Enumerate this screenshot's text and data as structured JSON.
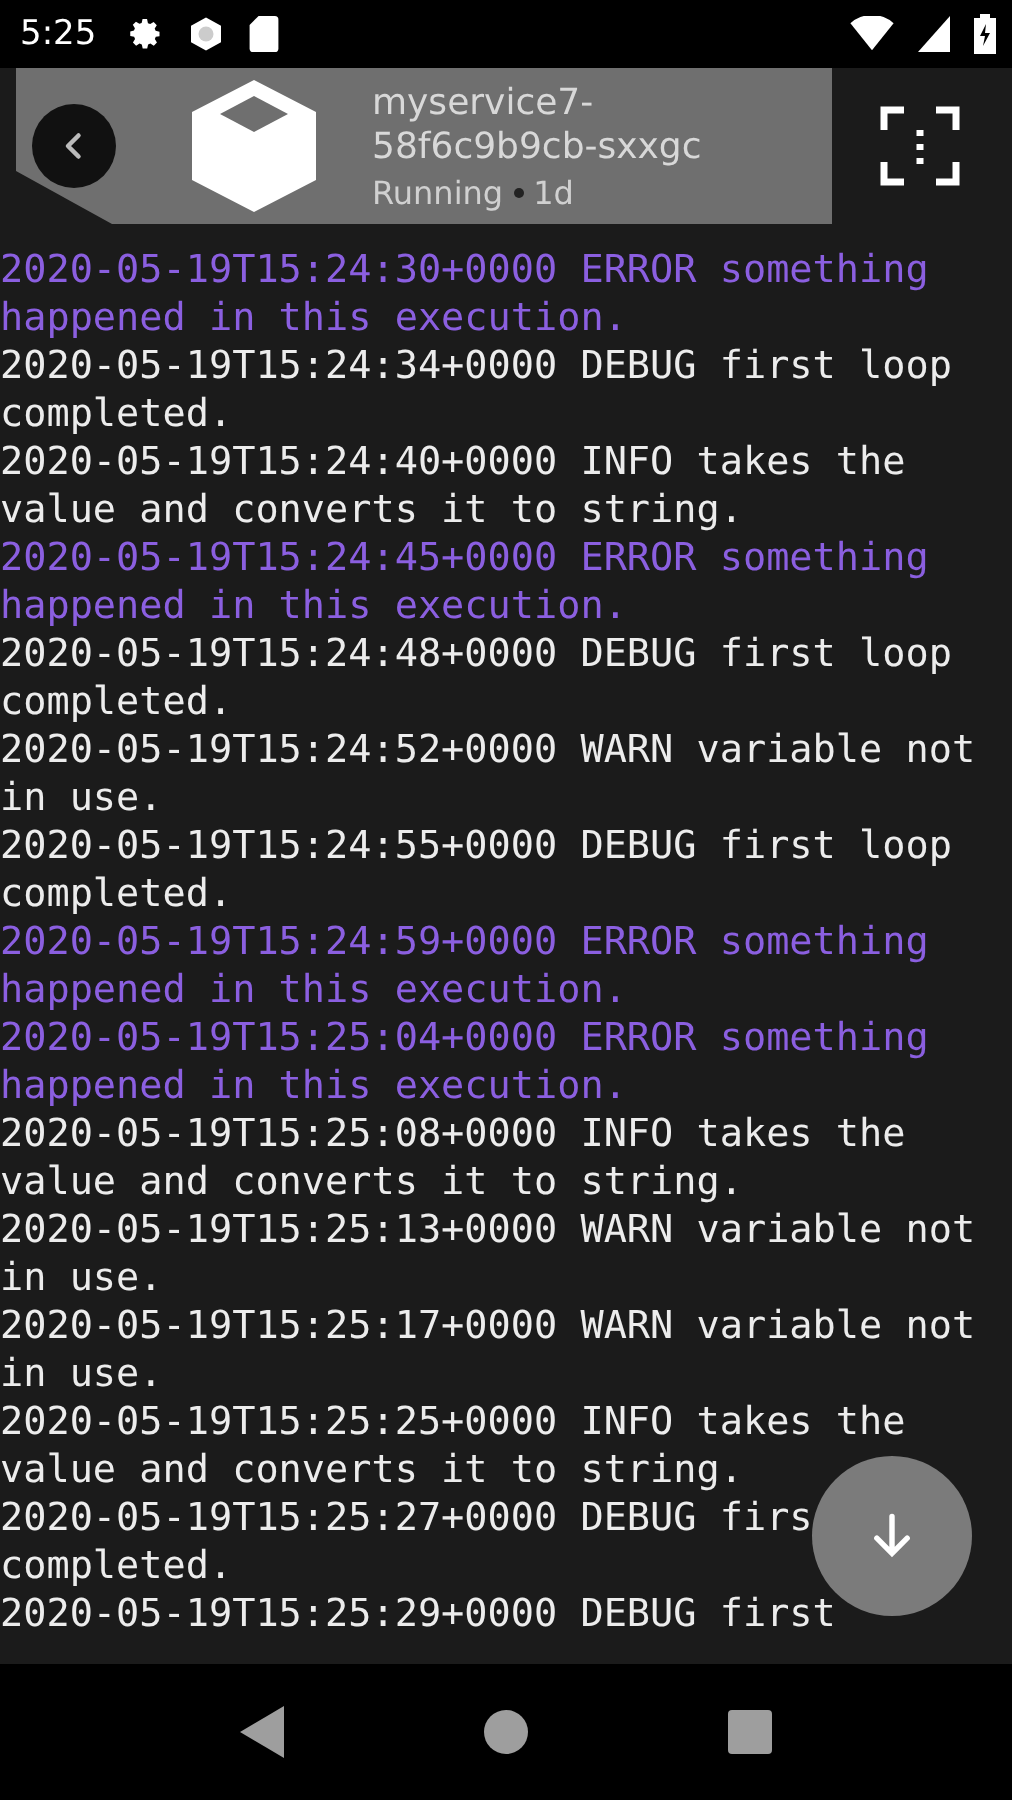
{
  "status_bar": {
    "time": "5:25"
  },
  "header": {
    "title": "myservice7-58f6c9b9cb-sxxgc",
    "status": "Running",
    "age": "1d"
  },
  "log": [
    {
      "kind": "error",
      "lines": [
        "2020-05-19T15:24:30+0000 ERROR something",
        "happened in this execution."
      ]
    },
    {
      "kind": "plain",
      "lines": [
        "2020-05-19T15:24:34+0000 DEBUG first loop",
        "completed."
      ]
    },
    {
      "kind": "plain",
      "lines": [
        "2020-05-19T15:24:40+0000 INFO takes the",
        "value and converts it to string."
      ]
    },
    {
      "kind": "error",
      "lines": [
        "2020-05-19T15:24:45+0000 ERROR something",
        "happened in this execution."
      ]
    },
    {
      "kind": "plain",
      "lines": [
        "2020-05-19T15:24:48+0000 DEBUG first loop",
        "completed."
      ]
    },
    {
      "kind": "plain",
      "lines": [
        "2020-05-19T15:24:52+0000 WARN variable not",
        "in use."
      ]
    },
    {
      "kind": "plain",
      "lines": [
        "2020-05-19T15:24:55+0000 DEBUG first loop",
        "completed."
      ]
    },
    {
      "kind": "error",
      "lines": [
        "2020-05-19T15:24:59+0000 ERROR something",
        "happened in this execution."
      ]
    },
    {
      "kind": "error",
      "lines": [
        "2020-05-19T15:25:04+0000 ERROR something",
        "happened in this execution."
      ]
    },
    {
      "kind": "plain",
      "lines": [
        "2020-05-19T15:25:08+0000 INFO takes the",
        "value and converts it to string."
      ]
    },
    {
      "kind": "plain",
      "lines": [
        "2020-05-19T15:25:13+0000 WARN variable not",
        "in use."
      ]
    },
    {
      "kind": "plain",
      "lines": [
        "2020-05-19T15:25:17+0000 WARN variable not",
        "in use."
      ]
    },
    {
      "kind": "plain",
      "lines": [
        "2020-05-19T15:25:25+0000 INFO takes the",
        "value and converts it to string."
      ]
    },
    {
      "kind": "plain",
      "lines": [
        "2020-05-19T15:25:27+0000 DEBUG firs",
        "completed."
      ]
    },
    {
      "kind": "plain",
      "lines": [
        "2020-05-19T15:25:29+0000 DEBUG first"
      ]
    }
  ]
}
